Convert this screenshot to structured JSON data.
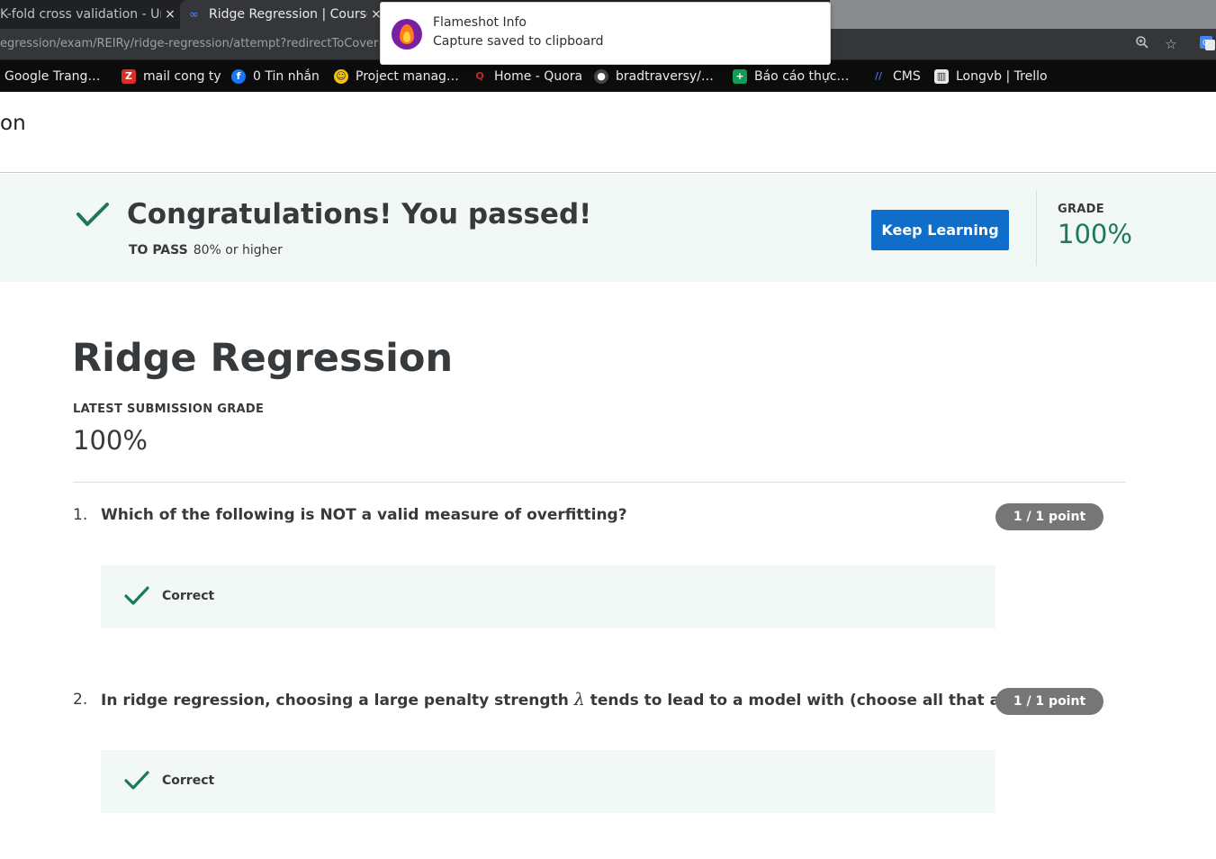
{
  "browser": {
    "tabs": [
      {
        "title": "K-fold cross validation - Un",
        "close": "×"
      },
      {
        "title": "Ridge Regression | Course",
        "close": "×"
      }
    ],
    "url": "egression/exam/REIRy/ridge-regression/attempt?redirectToCover=",
    "bookmarks": [
      {
        "label": "Google Trang…",
        "icon": "google-translate-icon",
        "color": "#4285f4"
      },
      {
        "label": "mail cong ty",
        "icon": "zimbra-mail-icon",
        "color": "#d93025"
      },
      {
        "label": "0 Tin nhắn",
        "icon": "facebook-icon",
        "color": "#1877f2"
      },
      {
        "label": "Project manag…",
        "icon": "project-icon",
        "color": "#f4c20d"
      },
      {
        "label": "Home - Quora",
        "icon": "quora-icon",
        "color": "#b92b27"
      },
      {
        "label": "bradtraversy/…",
        "icon": "github-icon",
        "color": "#333333"
      },
      {
        "label": "Báo cáo thực…",
        "icon": "sheets-icon",
        "color": "#0f9d58"
      },
      {
        "label": "CMS",
        "icon": "cms-icon",
        "color": "#4a6ee0"
      },
      {
        "label": "Longvb | Trello",
        "icon": "trello-icon",
        "color": "#e8e8e8"
      }
    ]
  },
  "notification": {
    "title": "Flameshot Info",
    "body": "Capture saved to clipboard"
  },
  "header": {
    "cut_title": "on"
  },
  "banner": {
    "headline": "Congratulations! You passed!",
    "to_pass_label": "TO PASS",
    "to_pass_value": "80% or higher",
    "button_label": "Keep Learning",
    "grade_label": "GRADE",
    "grade_value": "100%",
    "accent": "#1b7a5e",
    "button_color": "#0f6ec9"
  },
  "main": {
    "title": "Ridge Regression",
    "latest_label": "LATEST SUBMISSION GRADE",
    "latest_value": "100%",
    "questions": [
      {
        "number": "1.",
        "text": "Which of the following is NOT a valid measure of overfitting?",
        "points": "1 / 1 point",
        "result": "Correct"
      },
      {
        "number": "2.",
        "text_before": "In ridge regression, choosing a large penalty strength",
        "symbol": "λ",
        "text_after": "tends to lead to a model with (choose all that apply):",
        "points": "1 / 1 point",
        "result": "Correct"
      }
    ]
  }
}
